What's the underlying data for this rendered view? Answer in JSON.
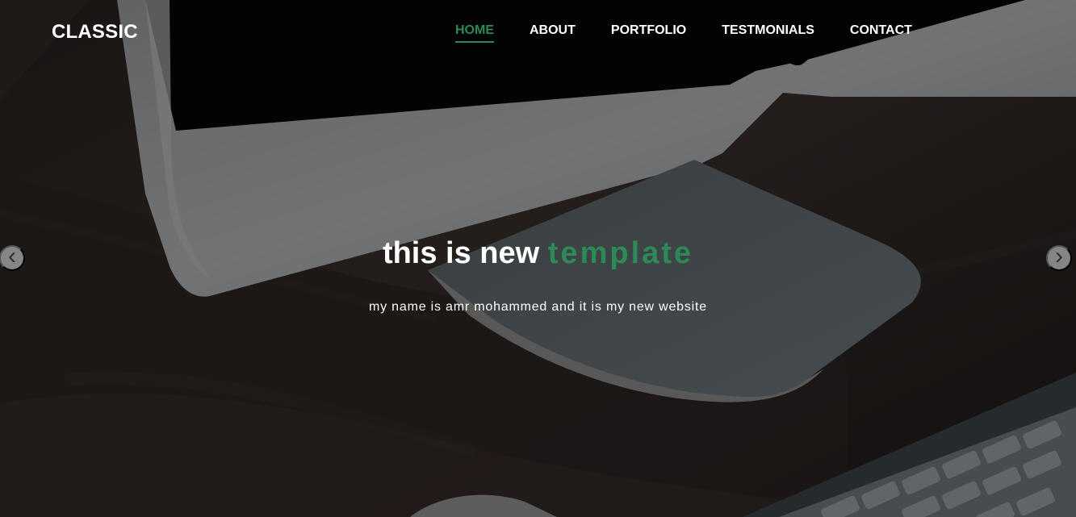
{
  "header": {
    "brand": "CLASSIC",
    "nav": [
      {
        "label": "HOME",
        "active": true
      },
      {
        "label": "ABOUT",
        "active": false
      },
      {
        "label": "PORTFOLIO",
        "active": false
      },
      {
        "label": "TESTMONIALS",
        "active": false
      },
      {
        "label": "CONTACT",
        "active": false
      }
    ]
  },
  "hero": {
    "headline_prefix": "this is new",
    "headline_accent": "template",
    "subtitle": "my name is amr mohammed and it is my new website"
  },
  "carousel": {
    "previous_icon": "‹",
    "next_icon": "›"
  },
  "theme": {
    "accent": "#2b8a55",
    "text": "#ffffff",
    "wood": "#3a312d",
    "monitor": "#aeb0b3"
  }
}
